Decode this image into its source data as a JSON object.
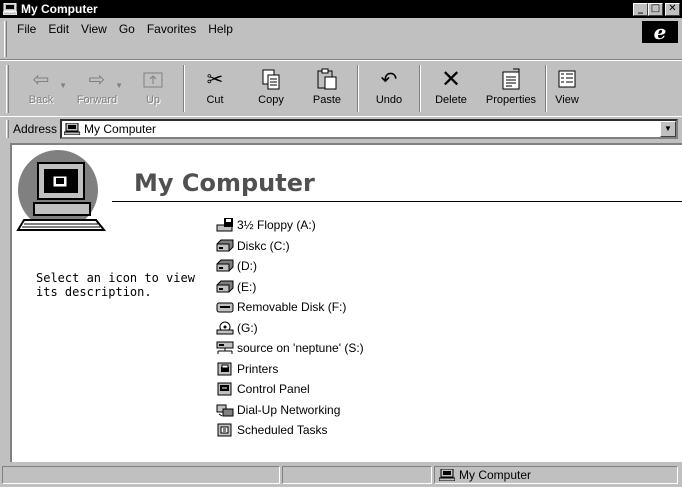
{
  "window": {
    "title": "My Computer"
  },
  "menu": [
    "File",
    "Edit",
    "View",
    "Go",
    "Favorites",
    "Help"
  ],
  "toolbar": {
    "back": "Back",
    "forward": "Forward",
    "up": "Up",
    "cut": "Cut",
    "copy": "Copy",
    "paste": "Paste",
    "undo": "Undo",
    "delete": "Delete",
    "properties": "Properties",
    "view": "View"
  },
  "address": {
    "label": "Address",
    "value": "My Computer"
  },
  "main": {
    "title": "My Computer",
    "hint": "Select an icon to view its description.",
    "items": [
      {
        "label": "3½ Floppy (A:)",
        "icon": "floppy-icon"
      },
      {
        "label": "Diskc (C:)",
        "icon": "hard-drive-icon"
      },
      {
        "label": "(D:)",
        "icon": "hard-drive-icon"
      },
      {
        "label": "(E:)",
        "icon": "hard-drive-icon"
      },
      {
        "label": "Removable Disk (F:)",
        "icon": "removable-disk-icon"
      },
      {
        "label": "(G:)",
        "icon": "cdrom-icon"
      },
      {
        "label": "source on 'neptune' (S:)",
        "icon": "network-drive-icon"
      },
      {
        "label": "Printers",
        "icon": "printers-folder-icon"
      },
      {
        "label": "Control Panel",
        "icon": "control-panel-icon"
      },
      {
        "label": "Dial-Up Networking",
        "icon": "dialup-networking-icon"
      },
      {
        "label": "Scheduled Tasks",
        "icon": "scheduled-tasks-icon"
      }
    ]
  },
  "status": {
    "right": "My Computer"
  }
}
